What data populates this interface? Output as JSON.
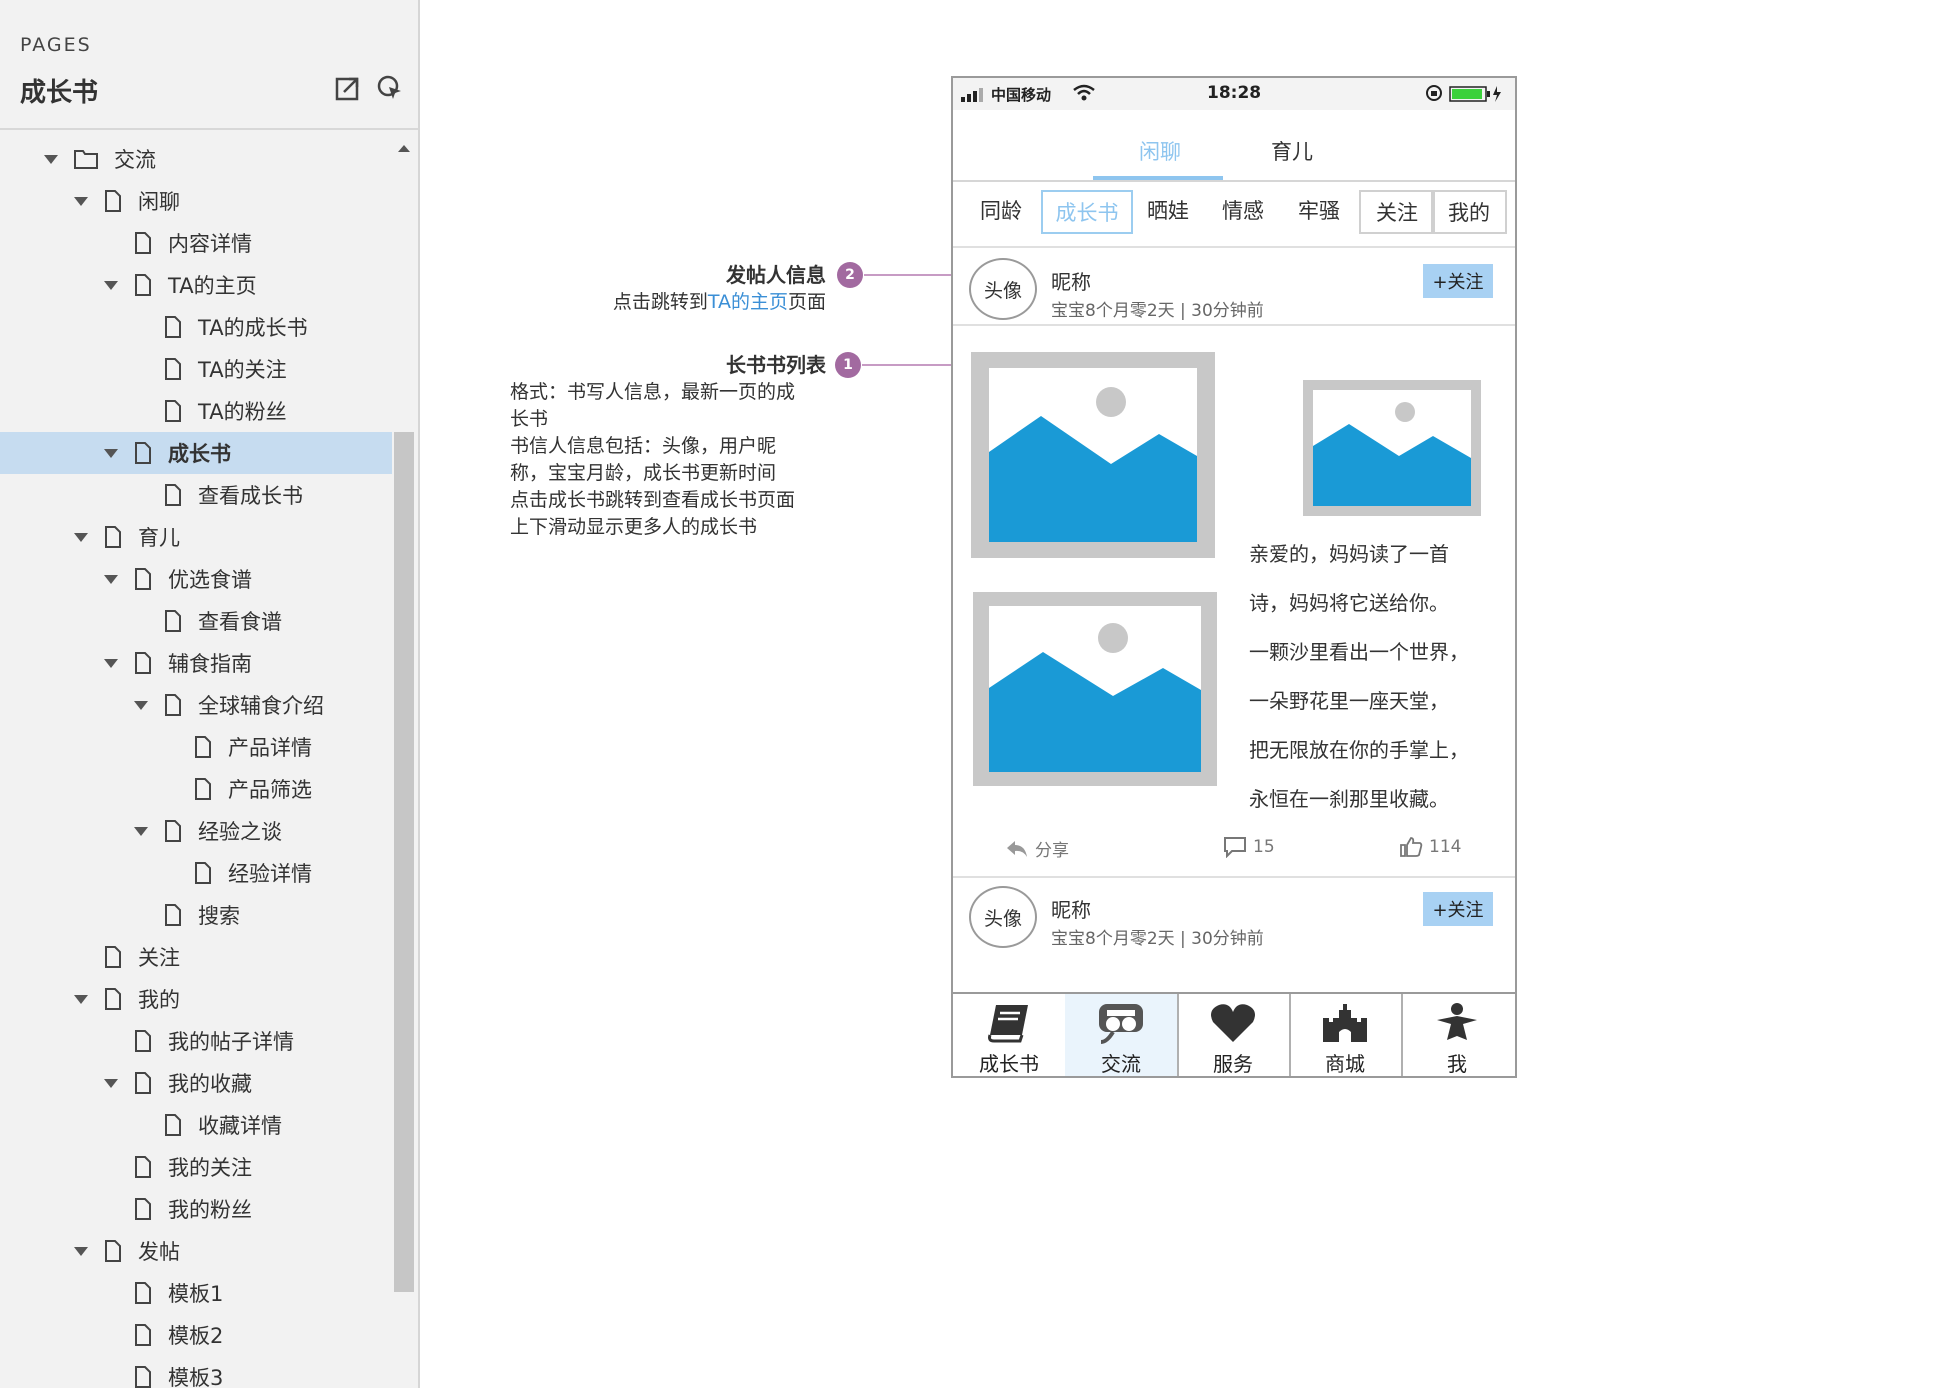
{
  "sidebar": {
    "label": "PAGES",
    "title": "成长书",
    "items": [
      {
        "label": "交流",
        "level": 0,
        "expanded": true,
        "icon": "folder-icon"
      },
      {
        "label": "闲聊",
        "level": 1,
        "expanded": true,
        "icon": "page-icon"
      },
      {
        "label": "内容详情",
        "level": 2,
        "expanded": false,
        "icon": "page-icon"
      },
      {
        "label": "TA的主页",
        "level": 2,
        "expanded": true,
        "icon": "page-icon"
      },
      {
        "label": "TA的成长书",
        "level": 3,
        "expanded": false,
        "icon": "page-icon"
      },
      {
        "label": "TA的关注",
        "level": 3,
        "expanded": false,
        "icon": "page-icon"
      },
      {
        "label": "TA的粉丝",
        "level": 3,
        "expanded": false,
        "icon": "page-icon"
      },
      {
        "label": "成长书",
        "level": 2,
        "expanded": true,
        "icon": "page-icon",
        "selected": true
      },
      {
        "label": "查看成长书",
        "level": 3,
        "expanded": false,
        "icon": "page-icon"
      },
      {
        "label": "育儿",
        "level": 1,
        "expanded": true,
        "icon": "page-icon"
      },
      {
        "label": "优选食谱",
        "level": 2,
        "expanded": true,
        "icon": "page-icon"
      },
      {
        "label": "查看食谱",
        "level": 3,
        "expanded": false,
        "icon": "page-icon"
      },
      {
        "label": "辅食指南",
        "level": 2,
        "expanded": true,
        "icon": "page-icon"
      },
      {
        "label": "全球辅食介绍",
        "level": 3,
        "expanded": true,
        "icon": "page-icon"
      },
      {
        "label": "产品详情",
        "level": 4,
        "expanded": false,
        "icon": "page-icon"
      },
      {
        "label": "产品筛选",
        "level": 4,
        "expanded": false,
        "icon": "page-icon"
      },
      {
        "label": "经验之谈",
        "level": 3,
        "expanded": true,
        "icon": "page-icon"
      },
      {
        "label": "经验详情",
        "level": 4,
        "expanded": false,
        "icon": "page-icon"
      },
      {
        "label": "搜索",
        "level": 3,
        "expanded": false,
        "icon": "page-icon"
      },
      {
        "label": "关注",
        "level": 1,
        "expanded": false,
        "icon": "page-icon"
      },
      {
        "label": "我的",
        "level": 1,
        "expanded": true,
        "icon": "page-icon"
      },
      {
        "label": "我的帖子详情",
        "level": 2,
        "expanded": false,
        "icon": "page-icon"
      },
      {
        "label": "我的收藏",
        "level": 2,
        "expanded": true,
        "icon": "page-icon"
      },
      {
        "label": "收藏详情",
        "level": 3,
        "expanded": false,
        "icon": "page-icon"
      },
      {
        "label": "我的关注",
        "level": 2,
        "expanded": false,
        "icon": "page-icon"
      },
      {
        "label": "我的粉丝",
        "level": 2,
        "expanded": false,
        "icon": "page-icon"
      },
      {
        "label": "发帖",
        "level": 1,
        "expanded": true,
        "icon": "page-icon"
      },
      {
        "label": "模板1",
        "level": 2,
        "expanded": false,
        "icon": "page-icon"
      },
      {
        "label": "模板2",
        "level": 2,
        "expanded": false,
        "icon": "page-icon"
      },
      {
        "label": "模板3",
        "level": 2,
        "expanded": false,
        "icon": "page-icon"
      }
    ]
  },
  "annotations": {
    "a2": {
      "badge": "2",
      "title": "发帖人信息",
      "line_prefix": "点击跳转到",
      "line_link": "TA的主页",
      "line_suffix": "页面"
    },
    "a1": {
      "badge": "1",
      "title": "长书书列表",
      "lines": [
        "格式：书写人信息，最新一页的成",
        "长书",
        "书信人信息包括：头像，用户昵",
        "称，宝宝月龄，成长书更新时间",
        "点击成长书跳转到查看成长书页面",
        "上下滑动显示更多人的成长书"
      ]
    }
  },
  "phone": {
    "status": {
      "carrier": "中国移动",
      "time": "18:28"
    },
    "top_tabs": [
      {
        "label": "闲聊",
        "active": true
      },
      {
        "label": "育儿",
        "active": false
      }
    ],
    "sub_tabs": [
      {
        "label": "同龄"
      },
      {
        "label": "成长书",
        "active": true
      },
      {
        "label": "晒娃"
      },
      {
        "label": "情感"
      },
      {
        "label": "牢骚"
      },
      {
        "label": "关注"
      },
      {
        "label": "我的"
      }
    ],
    "posts": [
      {
        "avatar": "头像",
        "nickname": "昵称",
        "meta": "宝宝8个月零2天 |  30分钟前",
        "follow": "+关注"
      },
      {
        "avatar": "头像",
        "nickname": "昵称",
        "meta": "宝宝8个月零2天 |  30分钟前",
        "follow": "+关注"
      }
    ],
    "poem": [
      "亲爱的，妈妈读了一首",
      "诗，妈妈将它送给你。",
      "一颗沙里看出一个世界，",
      "一朵野花里一座天堂，",
      "把无限放在你的手掌上，",
      "永恒在一刹那里收藏。"
    ],
    "actions": {
      "share": "分享",
      "comments": "15",
      "likes": "114"
    },
    "bottom_nav": [
      {
        "label": "成长书",
        "icon": "book-icon"
      },
      {
        "label": "交流",
        "icon": "chat-icon",
        "active": true
      },
      {
        "label": "服务",
        "icon": "heart-icon"
      },
      {
        "label": "商城",
        "icon": "castle-icon"
      },
      {
        "label": "我",
        "icon": "person-icon"
      }
    ]
  },
  "colors": {
    "accent": "#8ec5ef",
    "follow_bg": "#a8d1f3",
    "badge": "#a26aa0",
    "image_blue": "#1a9ad6",
    "selected_row": "#c6dcf0"
  }
}
